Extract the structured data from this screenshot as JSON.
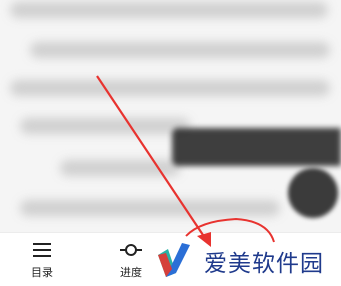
{
  "toolbar": {
    "items": [
      {
        "label": "目录",
        "icon": "menu-icon"
      },
      {
        "label": "进度",
        "icon": "progress-icon"
      }
    ]
  },
  "watermark": {
    "text": "爱美软件园"
  },
  "colors": {
    "annotation": "#e8332f",
    "watermark_text": "#1f3a8c",
    "logo_red": "#e8332f",
    "logo_blue": "#2b6fd6",
    "logo_teal": "#28b3a6"
  }
}
